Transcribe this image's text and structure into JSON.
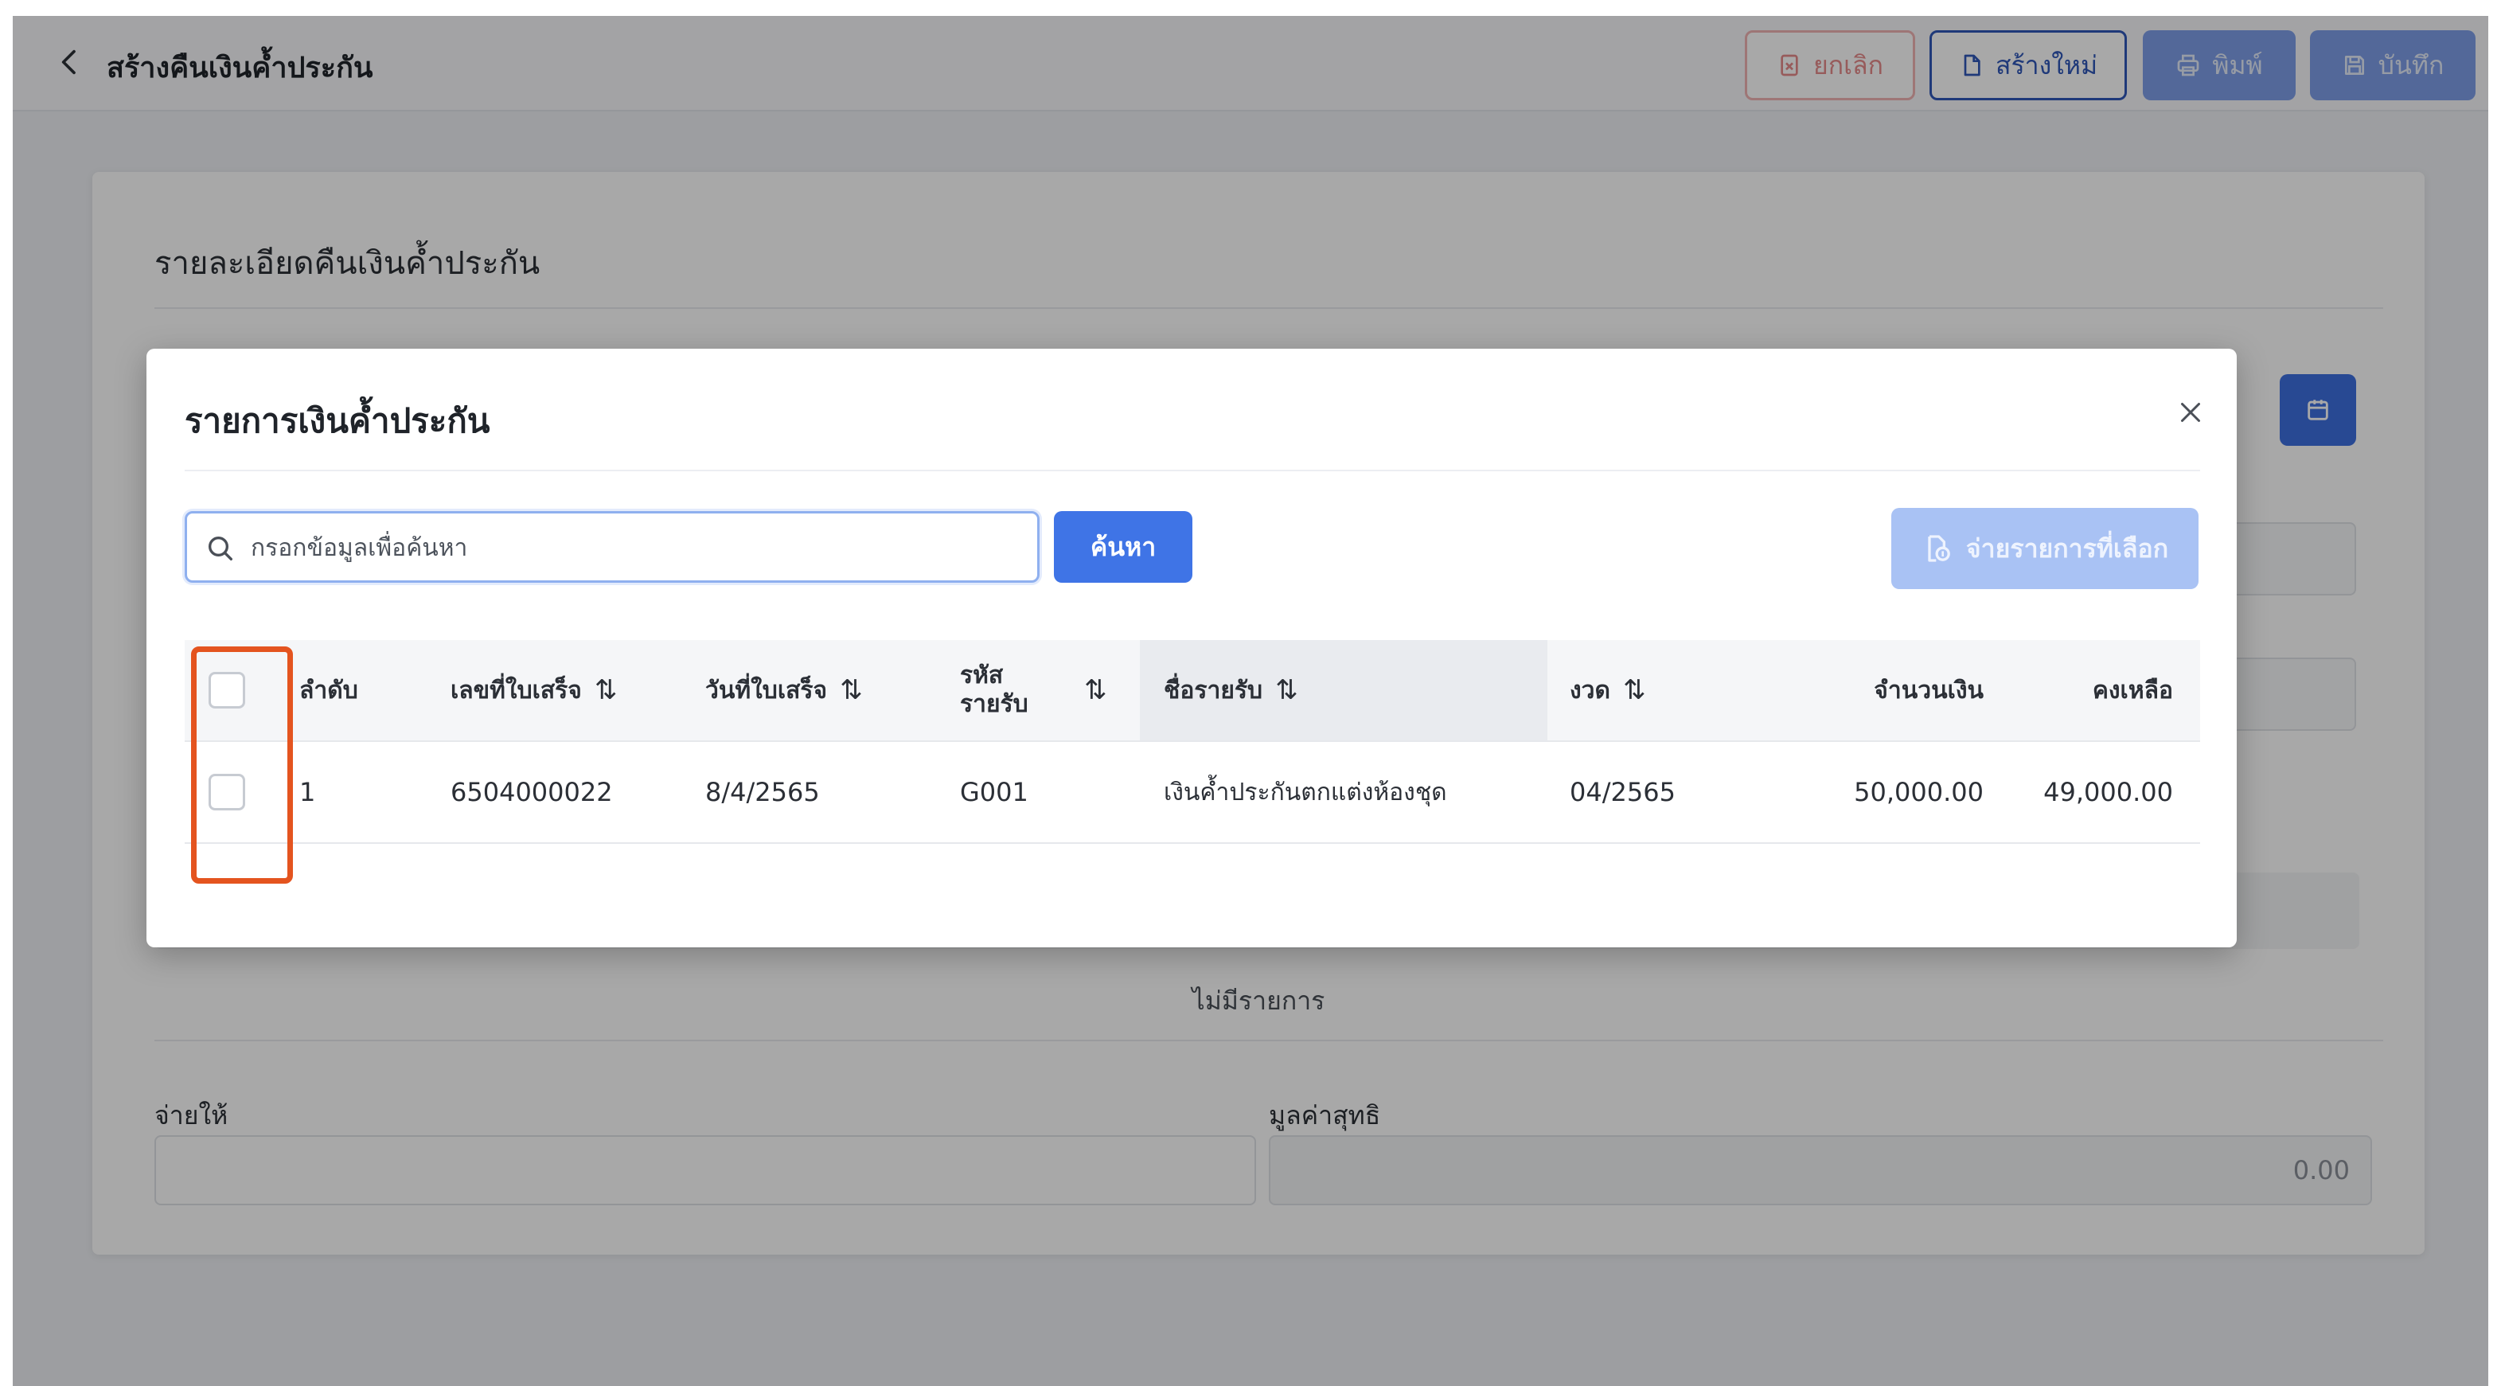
{
  "header": {
    "title": "สร้างคืนเงินค้ำประกัน",
    "buttons": {
      "cancel": "ยกเลิก",
      "create_new": "สร้างใหม่",
      "print": "พิมพ์",
      "save": "บันทึก"
    }
  },
  "card": {
    "title": "รายละเอียดคืนเงินค้ำประกัน",
    "empty_text": "ไม่มีรายการ",
    "pay_to_label": "จ่ายให้",
    "net_value_label": "มูลค่าสุทธิ",
    "net_value": "0.00"
  },
  "modal": {
    "title": "รายการเงินค้ำประกัน",
    "search": {
      "placeholder": "กรอกข้อมูลเพื่อค้นหา",
      "button": "ค้นหา"
    },
    "pay_selected_button": "จ่ายรายการที่เลือก",
    "table": {
      "columns": {
        "seq": "ลำดับ",
        "receipt_no": "เลขที่ใบเสร็จ",
        "receipt_date": "วันที่ใบเสร็จ",
        "income_code_line1": "รหัส",
        "income_code_line2": "รายรับ",
        "income_name": "ชื่อรายรับ",
        "period": "งวด",
        "amount": "จำนวนเงิน",
        "balance": "คงเหลือ"
      },
      "sort_glyph": "⇅",
      "rows": [
        {
          "seq": "1",
          "receipt_no": "6504000022",
          "receipt_date": "8/4/2565",
          "income_code": "G001",
          "income_name": "เงินค้ำประกันตกแต่งห้องชุด",
          "period": "04/2565",
          "amount": "50,000.00",
          "balance": "49,000.00"
        }
      ]
    }
  },
  "colors": {
    "primary": "#3f74e6",
    "primary_disabled": "#a9c2f4",
    "highlight": "#e4541f",
    "danger_border": "#f0b3b3"
  }
}
